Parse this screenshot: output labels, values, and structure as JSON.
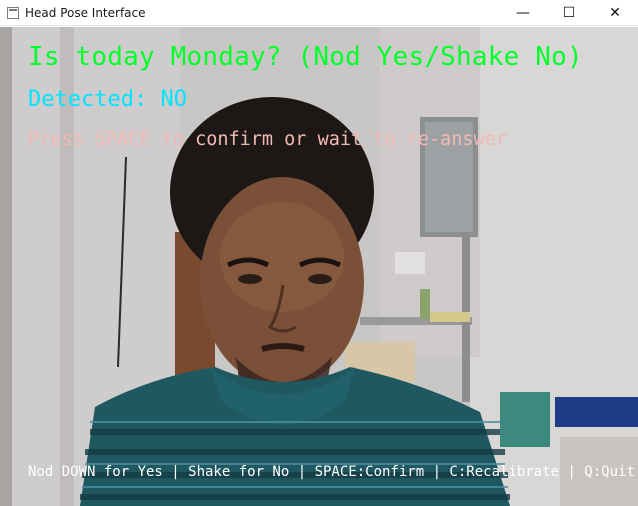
{
  "window": {
    "title": "Head Pose Interface",
    "controls": {
      "minimize": "—",
      "maximize": "☐",
      "close": "✕"
    }
  },
  "overlay": {
    "question": "Is today Monday? (Nod Yes/Shake No)",
    "detected": "Detected: NO",
    "instruction": "Press SPACE to confirm or wait to re-answer",
    "footer": "Nod DOWN for Yes | Shake for No | SPACE:Confirm | C:Recalibrate | Q:Quit"
  },
  "colors": {
    "question": "#00ff2a",
    "detected": "#00e5ff",
    "instruction": "#f2b9b4",
    "footer": "#ffffff"
  }
}
